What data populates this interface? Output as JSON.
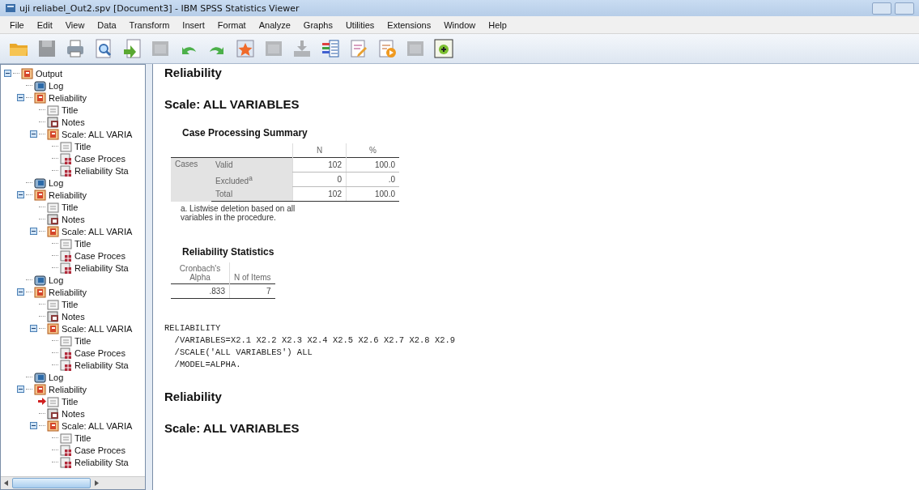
{
  "window": {
    "title": "uji reliabel_Out2.spv [Document3] - IBM SPSS Statistics Viewer"
  },
  "menu": [
    "File",
    "Edit",
    "View",
    "Data",
    "Transform",
    "Insert",
    "Format",
    "Analyze",
    "Graphs",
    "Utilities",
    "Extensions",
    "Window",
    "Help"
  ],
  "toolbar": [
    {
      "kind": "open",
      "disabled": false
    },
    {
      "kind": "save",
      "disabled": true
    },
    {
      "kind": "print",
      "disabled": false
    },
    {
      "kind": "preview",
      "disabled": false
    },
    {
      "kind": "export",
      "disabled": false
    },
    {
      "kind": "recall",
      "disabled": true
    },
    {
      "kind": "undo",
      "disabled": false
    },
    {
      "kind": "redo",
      "disabled": false
    },
    {
      "kind": "goto",
      "disabled": false
    },
    {
      "kind": "pivot",
      "disabled": true
    },
    {
      "kind": "insert",
      "disabled": true
    },
    {
      "kind": "variables",
      "disabled": false
    },
    {
      "kind": "edit",
      "disabled": false
    },
    {
      "kind": "script",
      "disabled": false
    },
    {
      "kind": "window",
      "disabled": true
    },
    {
      "kind": "designate",
      "disabled": false
    }
  ],
  "outline": [
    {
      "label": "Output",
      "kind": "heading",
      "expanded": true,
      "current": false,
      "children": [
        {
          "label": "Log",
          "kind": "log",
          "current": false
        },
        {
          "label": "Reliability",
          "kind": "heading",
          "expanded": true,
          "current": false,
          "children": [
            {
              "label": "Title",
              "kind": "title",
              "current": false
            },
            {
              "label": "Notes",
              "kind": "notes",
              "current": false
            },
            {
              "label": "Scale: ALL VARIA",
              "kind": "heading",
              "expanded": true,
              "current": false,
              "children": [
                {
                  "label": "Title",
                  "kind": "title",
                  "current": false
                },
                {
                  "label": "Case Proces",
                  "kind": "table",
                  "current": false
                },
                {
                  "label": "Reliability Sta",
                  "kind": "table",
                  "current": false
                }
              ]
            }
          ]
        },
        {
          "label": "Log",
          "kind": "log",
          "current": false
        },
        {
          "label": "Reliability",
          "kind": "heading",
          "expanded": true,
          "current": false,
          "children": [
            {
              "label": "Title",
              "kind": "title",
              "current": false
            },
            {
              "label": "Notes",
              "kind": "notes",
              "current": false
            },
            {
              "label": "Scale: ALL VARIA",
              "kind": "heading",
              "expanded": true,
              "current": false,
              "children": [
                {
                  "label": "Title",
                  "kind": "title",
                  "current": false
                },
                {
                  "label": "Case Proces",
                  "kind": "table",
                  "current": false
                },
                {
                  "label": "Reliability Sta",
                  "kind": "table",
                  "current": false
                }
              ]
            }
          ]
        },
        {
          "label": "Log",
          "kind": "log",
          "current": false
        },
        {
          "label": "Reliability",
          "kind": "heading",
          "expanded": true,
          "current": false,
          "children": [
            {
              "label": "Title",
              "kind": "title",
              "current": false
            },
            {
              "label": "Notes",
              "kind": "notes",
              "current": false
            },
            {
              "label": "Scale: ALL VARIA",
              "kind": "heading",
              "expanded": true,
              "current": false,
              "children": [
                {
                  "label": "Title",
                  "kind": "title",
                  "current": false
                },
                {
                  "label": "Case Proces",
                  "kind": "table",
                  "current": false
                },
                {
                  "label": "Reliability Sta",
                  "kind": "table",
                  "current": false
                }
              ]
            }
          ]
        },
        {
          "label": "Log",
          "kind": "log",
          "current": false
        },
        {
          "label": "Reliability",
          "kind": "heading",
          "expanded": true,
          "current": false,
          "children": [
            {
              "label": "Title",
              "kind": "title",
              "current": true
            },
            {
              "label": "Notes",
              "kind": "notes",
              "current": false
            },
            {
              "label": "Scale: ALL VARIA",
              "kind": "heading",
              "expanded": true,
              "current": false,
              "children": [
                {
                  "label": "Title",
                  "kind": "title",
                  "current": false
                },
                {
                  "label": "Case Proces",
                  "kind": "table",
                  "current": false
                },
                {
                  "label": "Reliability Sta",
                  "kind": "table",
                  "current": false
                }
              ]
            }
          ]
        }
      ]
    }
  ],
  "output": [
    {
      "kind": "heading",
      "text": "Reliability"
    },
    {
      "kind": "subheading",
      "text": "Scale: ALL VARIABLES"
    },
    {
      "kind": "grouped_table",
      "title": "Case Processing Summary",
      "columns": [
        "N",
        "%"
      ],
      "group": "Cases",
      "rows": [
        {
          "label": "Valid",
          "cells": [
            "102",
            "100.0"
          ]
        },
        {
          "label": "Excluded$^{a}$",
          "cells": [
            "0",
            ".0"
          ]
        },
        {
          "label": "Total",
          "cells": [
            "102",
            "100.0"
          ]
        }
      ],
      "footnote": "a. Listwise deletion based on all variables in the procedure."
    },
    {
      "kind": "plain_table",
      "title": "Reliability Statistics",
      "columns": [
        "Cronbach's Alpha",
        "N of Items"
      ],
      "rows": [
        {
          "cells": [
            ".833",
            "7"
          ]
        }
      ]
    },
    {
      "kind": "syntax",
      "lines": [
        "RELIABILITY",
        "  /VARIABLES=X2.1 X2.2 X2.3 X2.4 X2.5 X2.6 X2.7 X2.8 X2.9",
        "  /SCALE('ALL VARIABLES') ALL",
        "  /MODEL=ALPHA."
      ]
    },
    {
      "kind": "heading",
      "text": "Reliability"
    },
    {
      "kind": "subheading",
      "text": "Scale: ALL VARIABLES"
    }
  ]
}
